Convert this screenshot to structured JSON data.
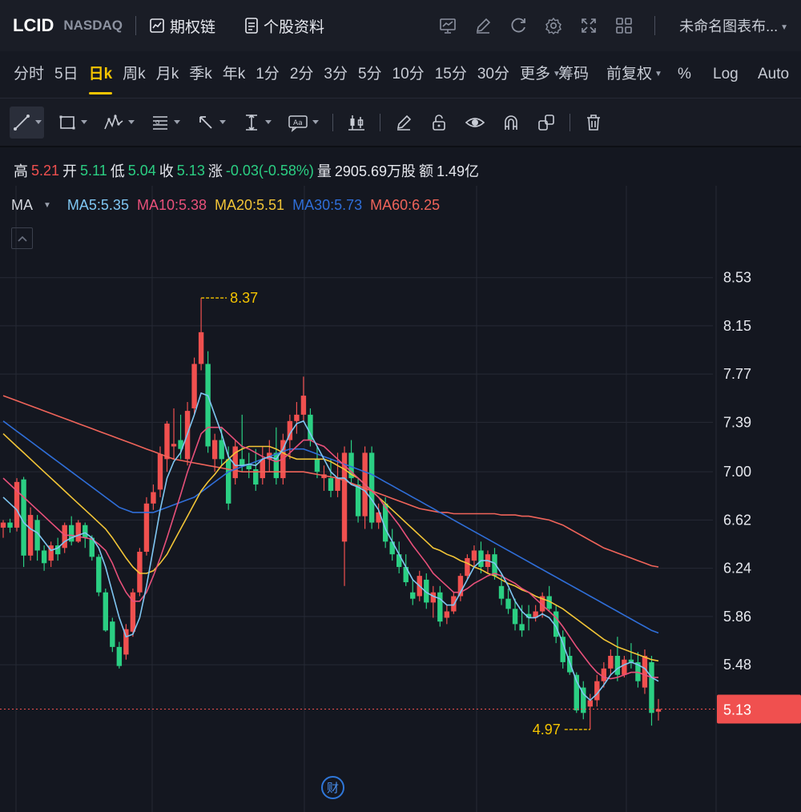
{
  "topbar": {
    "symbol": "LCID",
    "exchange": "NASDAQ",
    "options_chain": "期权链",
    "stock_info": "个股资料",
    "layout_name": "未命名图表布..."
  },
  "periods": [
    "分时",
    "5日",
    "日k",
    "周k",
    "月k",
    "季k",
    "年k",
    "1分",
    "2分",
    "3分",
    "5分",
    "10分",
    "15分",
    "30分",
    "更多"
  ],
  "active_period": "日k",
  "period_right": {
    "chips": "筹码",
    "adjust": "前复权",
    "percent": "%",
    "log": "Log",
    "auto": "Auto"
  },
  "quote": {
    "high_label": "高",
    "high": "5.21",
    "open_label": "开",
    "open": "5.11",
    "low_label": "低",
    "low": "5.04",
    "close_label": "收",
    "close": "5.13",
    "change_label": "涨",
    "change": "-0.03(-0.58%)",
    "volume_label": "量",
    "volume": "2905.69万股",
    "amount_label": "额",
    "amount": "1.49亿"
  },
  "ma": {
    "label": "MA",
    "ma5": "MA5:5.35",
    "ma10": "MA10:5.38",
    "ma20": "MA20:5.51",
    "ma30": "MA30:5.73",
    "ma60": "MA60:6.25",
    "colors": {
      "ma5": "#7fc6f2",
      "ma10": "#e8507a",
      "ma20": "#f2c537",
      "ma30": "#2f6ed8",
      "ma60": "#f0645a"
    }
  },
  "chart_data": {
    "type": "candlestick",
    "ylim": [
      4.78,
      8.85
    ],
    "y_ticks": [
      "8.53",
      "8.15",
      "7.77",
      "7.39",
      "7.00",
      "6.62",
      "6.24",
      "5.86",
      "5.48",
      "5.13"
    ],
    "high_marker": "8.37",
    "low_marker": "4.97",
    "last_price": "5.13",
    "colors": {
      "up": "#f0504f",
      "down": "#2bcf83",
      "grid": "#262a35"
    },
    "candles": [
      [
        6.56,
        6.62,
        6.48,
        6.6
      ],
      [
        6.6,
        6.63,
        6.52,
        6.56
      ],
      [
        6.56,
        6.95,
        6.53,
        6.92
      ],
      [
        6.94,
        6.96,
        6.25,
        6.34
      ],
      [
        6.34,
        6.72,
        6.3,
        6.66
      ],
      [
        6.62,
        6.66,
        6.3,
        6.38
      ],
      [
        6.38,
        6.42,
        6.22,
        6.28
      ],
      [
        6.3,
        6.45,
        6.25,
        6.42
      ],
      [
        6.42,
        6.48,
        6.3,
        6.35
      ],
      [
        6.4,
        6.6,
        6.36,
        6.58
      ],
      [
        6.58,
        6.65,
        6.42,
        6.45
      ],
      [
        6.45,
        6.62,
        6.44,
        6.6
      ],
      [
        6.58,
        6.6,
        6.4,
        6.48
      ],
      [
        6.48,
        6.5,
        6.3,
        6.33
      ],
      [
        6.33,
        6.35,
        6.02,
        6.05
      ],
      [
        6.05,
        6.08,
        5.74,
        5.75
      ],
      [
        5.82,
        5.85,
        5.58,
        5.62
      ],
      [
        5.62,
        5.66,
        5.45,
        5.47
      ],
      [
        5.56,
        5.8,
        5.52,
        5.76
      ],
      [
        5.74,
        6.08,
        5.7,
        6.05
      ],
      [
        6.05,
        6.4,
        6.02,
        6.37
      ],
      [
        6.37,
        6.8,
        6.34,
        6.75
      ],
      [
        6.75,
        6.9,
        6.7,
        6.84
      ],
      [
        6.86,
        7.2,
        6.8,
        7.14
      ],
      [
        7.1,
        7.4,
        7.0,
        7.38
      ],
      [
        7.2,
        7.5,
        7.1,
        7.22
      ],
      [
        7.25,
        7.45,
        7.1,
        7.18
      ],
      [
        7.1,
        7.55,
        7.05,
        7.48
      ],
      [
        7.5,
        7.9,
        7.45,
        7.85
      ],
      [
        7.85,
        8.37,
        7.8,
        8.1
      ],
      [
        7.85,
        7.95,
        7.15,
        7.2
      ],
      [
        7.1,
        7.3,
        7.0,
        7.25
      ],
      [
        7.25,
        7.35,
        7.05,
        7.1
      ],
      [
        7.1,
        7.2,
        6.7,
        6.75
      ],
      [
        6.95,
        7.25,
        6.9,
        7.2
      ],
      [
        7.1,
        7.45,
        7.0,
        7.05
      ],
      [
        7.05,
        7.15,
        6.95,
        7.02
      ],
      [
        7.02,
        7.18,
        6.85,
        6.9
      ],
      [
        6.95,
        7.2,
        6.9,
        7.1
      ],
      [
        7.1,
        7.25,
        7.0,
        7.15
      ],
      [
        7.15,
        7.35,
        6.9,
        6.95
      ],
      [
        6.95,
        7.3,
        6.9,
        7.25
      ],
      [
        7.25,
        7.45,
        7.1,
        7.4
      ],
      [
        7.4,
        7.55,
        7.3,
        7.45
      ],
      [
        7.45,
        7.75,
        7.4,
        7.6
      ],
      [
        7.45,
        7.5,
        7.2,
        7.25
      ],
      [
        7.1,
        7.2,
        6.95,
        7.0
      ],
      [
        6.95,
        7.05,
        6.85,
        6.98
      ],
      [
        6.95,
        7.1,
        6.8,
        6.85
      ],
      [
        6.85,
        7.15,
        6.8,
        6.95
      ],
      [
        6.45,
        7.2,
        6.1,
        7.15
      ],
      [
        7.15,
        7.25,
        6.9,
        6.95
      ],
      [
        6.9,
        6.95,
        6.6,
        6.65
      ],
      [
        6.65,
        7.2,
        6.55,
        7.15
      ],
      [
        7.15,
        7.2,
        6.55,
        6.6
      ],
      [
        6.6,
        6.75,
        6.55,
        6.68
      ],
      [
        6.75,
        6.8,
        6.4,
        6.45
      ],
      [
        6.45,
        6.55,
        6.3,
        6.35
      ],
      [
        6.35,
        6.45,
        6.2,
        6.25
      ],
      [
        6.25,
        6.35,
        6.1,
        6.13
      ],
      [
        6.05,
        6.15,
        5.95,
        6.0
      ],
      [
        6.02,
        6.22,
        5.98,
        6.18
      ],
      [
        6.15,
        6.2,
        5.92,
        5.97
      ],
      [
        5.97,
        6.1,
        5.85,
        6.05
      ],
      [
        6.05,
        6.1,
        5.78,
        5.82
      ],
      [
        5.85,
        5.95,
        5.8,
        5.9
      ],
      [
        5.9,
        6.05,
        5.88,
        6.02
      ],
      [
        6.02,
        6.2,
        5.98,
        6.18
      ],
      [
        6.18,
        6.35,
        6.15,
        6.32
      ],
      [
        6.3,
        6.42,
        6.25,
        6.38
      ],
      [
        6.38,
        6.45,
        6.2,
        6.25
      ],
      [
        6.25,
        6.38,
        6.2,
        6.35
      ],
      [
        6.35,
        6.4,
        6.15,
        6.18
      ],
      [
        6.1,
        6.2,
        5.95,
        6.0
      ],
      [
        6.0,
        6.08,
        5.88,
        5.92
      ],
      [
        5.92,
        6.0,
        5.75,
        5.8
      ],
      [
        5.8,
        5.95,
        5.7,
        5.75
      ],
      [
        5.88,
        5.95,
        5.75,
        5.85
      ],
      [
        5.85,
        5.95,
        5.82,
        5.9
      ],
      [
        5.9,
        6.05,
        5.85,
        6.02
      ],
      [
        6.02,
        6.1,
        5.9,
        5.92
      ],
      [
        5.9,
        5.95,
        5.65,
        5.7
      ],
      [
        5.7,
        5.75,
        5.45,
        5.5
      ],
      [
        5.55,
        5.62,
        5.4,
        5.42
      ],
      [
        5.4,
        5.42,
        5.1,
        5.12
      ],
      [
        5.3,
        5.35,
        5.05,
        5.1
      ],
      [
        5.15,
        5.25,
        4.97,
        5.2
      ],
      [
        5.2,
        5.4,
        5.15,
        5.35
      ],
      [
        5.35,
        5.5,
        5.3,
        5.45
      ],
      [
        5.45,
        5.6,
        5.4,
        5.55
      ],
      [
        5.55,
        5.7,
        5.35,
        5.4
      ],
      [
        5.4,
        5.55,
        5.38,
        5.52
      ],
      [
        5.52,
        5.65,
        5.45,
        5.5
      ],
      [
        5.5,
        5.58,
        5.3,
        5.35
      ],
      [
        5.3,
        5.6,
        5.25,
        5.55
      ],
      [
        5.5,
        5.55,
        5.0,
        5.1
      ],
      [
        5.11,
        5.21,
        5.04,
        5.13
      ]
    ],
    "ma5": [
      6.8,
      6.75,
      6.7,
      6.6,
      6.55,
      6.52,
      6.45,
      6.38,
      6.4,
      6.45,
      6.48,
      6.5,
      6.52,
      6.48,
      6.4,
      6.25,
      6.05,
      5.85,
      5.7,
      5.72,
      5.85,
      6.1,
      6.4,
      6.7,
      6.95,
      7.08,
      7.15,
      7.3,
      7.45,
      7.62,
      7.6,
      7.45,
      7.3,
      7.12,
      7.05,
      7.05,
      7.06,
      7.05,
      7.1,
      7.12,
      7.1,
      7.18,
      7.3,
      7.38,
      7.4,
      7.3,
      7.2,
      7.1,
      7.0,
      6.95,
      6.95,
      6.9,
      6.88,
      6.85,
      6.78,
      6.7,
      6.55,
      6.45,
      6.35,
      6.25,
      6.15,
      6.1,
      6.05,
      6.02,
      6.0,
      5.95,
      5.95,
      6.05,
      6.15,
      6.25,
      6.3,
      6.3,
      6.28,
      6.2,
      6.1,
      5.98,
      5.9,
      5.85,
      5.85,
      5.88,
      5.85,
      5.78,
      5.65,
      5.5,
      5.35,
      5.25,
      5.2,
      5.25,
      5.32,
      5.4,
      5.45,
      5.48,
      5.5,
      5.48,
      5.45,
      5.38,
      5.35
    ],
    "ma10": [
      6.95,
      6.9,
      6.85,
      6.8,
      6.75,
      6.7,
      6.65,
      6.6,
      6.55,
      6.5,
      6.5,
      6.49,
      6.48,
      6.47,
      6.43,
      6.38,
      6.28,
      6.15,
      6.05,
      5.98,
      5.98,
      6.05,
      6.18,
      6.32,
      6.48,
      6.65,
      6.82,
      7.0,
      7.15,
      7.3,
      7.35,
      7.35,
      7.35,
      7.3,
      7.25,
      7.2,
      7.18,
      7.15,
      7.12,
      7.1,
      7.08,
      7.1,
      7.15,
      7.2,
      7.25,
      7.25,
      7.22,
      7.2,
      7.15,
      7.1,
      7.05,
      7.0,
      6.95,
      6.9,
      6.85,
      6.8,
      6.72,
      6.65,
      6.58,
      6.5,
      6.42,
      6.35,
      6.28,
      6.2,
      6.15,
      6.1,
      6.05,
      6.05,
      6.08,
      6.12,
      6.15,
      6.18,
      6.2,
      6.18,
      6.15,
      6.12,
      6.08,
      6.05,
      6.0,
      5.95,
      5.9,
      5.85,
      5.78,
      5.7,
      5.62,
      5.55,
      5.48,
      5.42,
      5.38,
      5.37,
      5.38,
      5.4,
      5.42,
      5.42,
      5.4,
      5.38,
      5.38
    ],
    "ma20": [
      7.3,
      7.25,
      7.2,
      7.15,
      7.1,
      7.05,
      7.0,
      6.95,
      6.9,
      6.85,
      6.8,
      6.75,
      6.7,
      6.65,
      6.6,
      6.55,
      6.48,
      6.4,
      6.32,
      6.25,
      6.2,
      6.2,
      6.22,
      6.28,
      6.35,
      6.45,
      6.55,
      6.65,
      6.75,
      6.85,
      6.92,
      6.98,
      7.05,
      7.1,
      7.15,
      7.18,
      7.2,
      7.2,
      7.2,
      7.2,
      7.18,
      7.15,
      7.12,
      7.1,
      7.1,
      7.1,
      7.1,
      7.1,
      7.08,
      7.05,
      7.02,
      6.98,
      6.95,
      6.9,
      6.85,
      6.8,
      6.75,
      6.7,
      6.65,
      6.6,
      6.55,
      6.5,
      6.45,
      6.4,
      6.38,
      6.35,
      6.33,
      6.3,
      6.28,
      6.25,
      6.23,
      6.2,
      6.18,
      6.15,
      6.12,
      6.1,
      6.07,
      6.05,
      6.02,
      6.0,
      5.98,
      5.95,
      5.92,
      5.88,
      5.84,
      5.8,
      5.76,
      5.72,
      5.68,
      5.65,
      5.62,
      5.6,
      5.58,
      5.56,
      5.54,
      5.52,
      5.51
    ],
    "ma30": [
      7.4,
      7.36,
      7.32,
      7.28,
      7.24,
      7.2,
      7.16,
      7.12,
      7.08,
      7.04,
      7.0,
      6.96,
      6.92,
      6.88,
      6.84,
      6.8,
      6.76,
      6.72,
      6.7,
      6.68,
      6.68,
      6.68,
      6.68,
      6.7,
      6.72,
      6.74,
      6.76,
      6.78,
      6.8,
      6.84,
      6.88,
      6.92,
      6.96,
      7.0,
      7.02,
      7.04,
      7.06,
      7.08,
      7.1,
      7.12,
      7.14,
      7.16,
      7.18,
      7.18,
      7.18,
      7.16,
      7.14,
      7.12,
      7.1,
      7.08,
      7.06,
      7.04,
      7.02,
      7.0,
      6.98,
      6.95,
      6.92,
      6.89,
      6.86,
      6.83,
      6.8,
      6.77,
      6.74,
      6.71,
      6.68,
      6.65,
      6.62,
      6.59,
      6.56,
      6.53,
      6.5,
      6.47,
      6.44,
      6.41,
      6.38,
      6.35,
      6.32,
      6.29,
      6.26,
      6.23,
      6.2,
      6.17,
      6.14,
      6.11,
      6.08,
      6.05,
      6.02,
      5.99,
      5.96,
      5.93,
      5.9,
      5.87,
      5.84,
      5.81,
      5.78,
      5.75,
      5.73
    ],
    "ma60": [
      7.6,
      7.58,
      7.56,
      7.54,
      7.52,
      7.5,
      7.48,
      7.46,
      7.44,
      7.42,
      7.4,
      7.38,
      7.36,
      7.34,
      7.32,
      7.3,
      7.28,
      7.26,
      7.24,
      7.22,
      7.2,
      7.18,
      7.16,
      7.14,
      7.12,
      7.1,
      7.09,
      7.08,
      7.07,
      7.06,
      7.05,
      7.04,
      7.03,
      7.02,
      7.01,
      7.0,
      7.0,
      7.0,
      7.0,
      7.0,
      7.0,
      7.0,
      7.0,
      7.0,
      7.0,
      6.99,
      6.98,
      6.97,
      6.96,
      6.95,
      6.93,
      6.91,
      6.89,
      6.87,
      6.85,
      6.83,
      6.81,
      6.79,
      6.77,
      6.75,
      6.73,
      6.71,
      6.7,
      6.69,
      6.68,
      6.68,
      6.67,
      6.67,
      6.67,
      6.67,
      6.67,
      6.67,
      6.67,
      6.66,
      6.66,
      6.66,
      6.65,
      6.65,
      6.64,
      6.63,
      6.62,
      6.6,
      6.58,
      6.55,
      6.52,
      6.49,
      6.46,
      6.43,
      6.4,
      6.38,
      6.36,
      6.34,
      6.32,
      6.3,
      6.28,
      6.26,
      6.25
    ]
  },
  "cai_label": "财"
}
